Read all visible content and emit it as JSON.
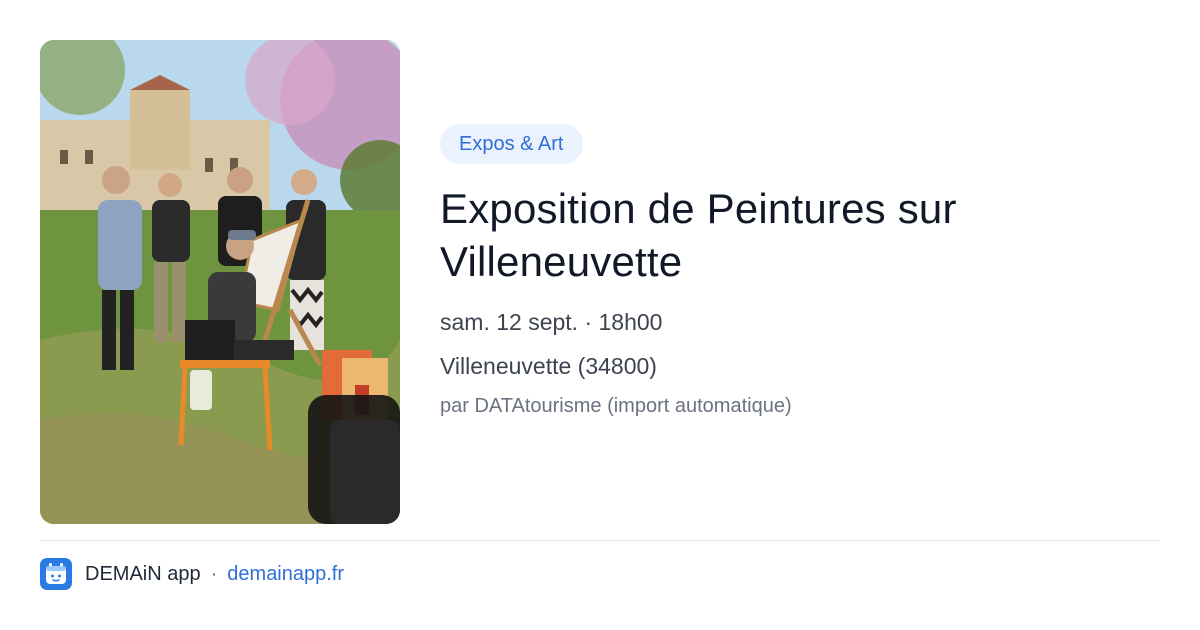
{
  "event": {
    "category": "Expos & Art",
    "title": "Exposition de Peintures sur Villeneuvette",
    "datetime": "sam. 12 sept. · 18h00",
    "location": "Villeneuvette (34800)",
    "source": "par DATAtourisme (import automatique)",
    "image_icon": "event-photo"
  },
  "footer": {
    "app_icon": "demain-app-icon",
    "app_name": "DEMAiN app",
    "separator": "·",
    "domain": "demainapp.fr"
  },
  "colors": {
    "accent": "#2f6fd6",
    "badge_bg": "#ebf2fd",
    "title": "#111827",
    "meta": "#3d4450",
    "muted": "#6b7280"
  }
}
